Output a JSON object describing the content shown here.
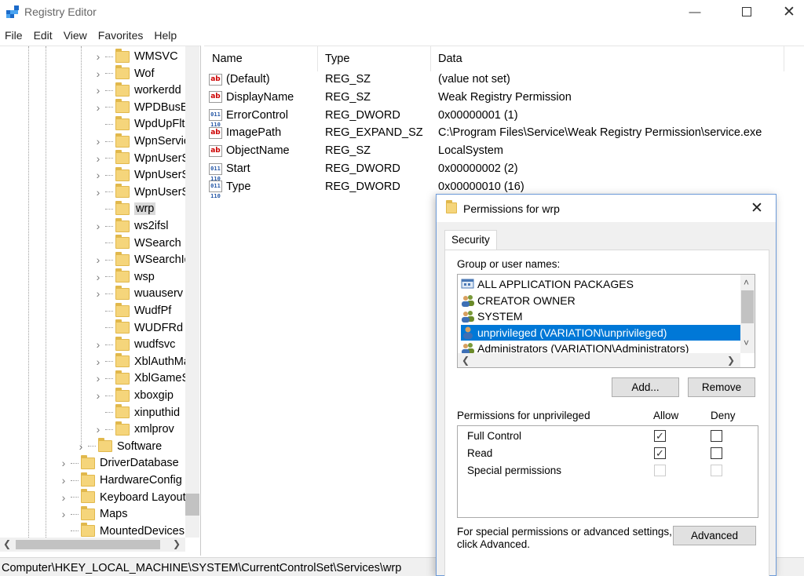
{
  "window": {
    "title": "Registry Editor"
  },
  "menu": [
    "File",
    "Edit",
    "View",
    "Favorites",
    "Help"
  ],
  "tree": {
    "services": [
      "WMSVC",
      "Wof",
      "workerdd",
      "WPDBusEn",
      "WpdUpFltr",
      "WpnServic",
      "WpnUserSe",
      "WpnUserSe",
      "WpnUserSe",
      "wrp",
      "ws2ifsl",
      "WSearch",
      "WSearchIdx",
      "wsp",
      "wuauserv",
      "WudfPf",
      "WUDFRd",
      "wudfsvc",
      "XblAuthMa",
      "XblGameSa",
      "xboxgip",
      "xinputhid",
      "xmlprov"
    ],
    "software": "Software",
    "system": [
      "DriverDatabase",
      "HardwareConfig",
      "Keyboard Layout",
      "Maps",
      "MountedDevices"
    ]
  },
  "list": {
    "columns": {
      "name": "Name",
      "type": "Type",
      "data": "Data"
    },
    "values": [
      {
        "name": "(Default)",
        "type": "REG_SZ",
        "data": "(value not set)",
        "icon": "string-value-icon"
      },
      {
        "name": "DisplayName",
        "type": "REG_SZ",
        "data": "Weak Registry Permission",
        "icon": "string-value-icon"
      },
      {
        "name": "ErrorControl",
        "type": "REG_DWORD",
        "data": "0x00000001 (1)",
        "icon": "binary-value-icon"
      },
      {
        "name": "ImagePath",
        "type": "REG_EXPAND_SZ",
        "data": "C:\\Program Files\\Service\\Weak Registry Permission\\service.exe",
        "icon": "string-value-icon"
      },
      {
        "name": "ObjectName",
        "type": "REG_SZ",
        "data": "LocalSystem",
        "icon": "string-value-icon"
      },
      {
        "name": "Start",
        "type": "REG_DWORD",
        "data": "0x00000002 (2)",
        "icon": "binary-value-icon"
      },
      {
        "name": "Type",
        "type": "REG_DWORD",
        "data": "0x00000010 (16)",
        "icon": "binary-value-icon"
      }
    ]
  },
  "status": "Computer\\HKEY_LOCAL_MACHINE\\SYSTEM\\CurrentControlSet\\Services\\wrp",
  "dialog": {
    "title": "Permissions for wrp",
    "tab": "Security",
    "group_label": "Group or user names:",
    "users": [
      {
        "name": "ALL APPLICATION PACKAGES",
        "icon": "packages-icon"
      },
      {
        "name": "CREATOR OWNER",
        "icon": "users-group-icon"
      },
      {
        "name": "SYSTEM",
        "icon": "users-group-icon"
      },
      {
        "name": "unprivileged (VARIATION\\unprivileged)",
        "icon": "user-icon"
      },
      {
        "name": "Administrators (VARIATION\\Administrators)",
        "icon": "users-group-icon"
      }
    ],
    "add_label": "Add...",
    "remove_label": "Remove",
    "perm_header": "Permissions for unprivileged",
    "allow_label": "Allow",
    "deny_label": "Deny",
    "permissions": [
      {
        "name": "Full Control",
        "allow": true,
        "deny": false,
        "enabled": true
      },
      {
        "name": "Read",
        "allow": true,
        "deny": false,
        "enabled": true
      },
      {
        "name": "Special permissions",
        "allow": false,
        "deny": false,
        "enabled": false
      }
    ],
    "advanced_text_1": "For special permissions or advanced settings,",
    "advanced_text_2": "click Advanced.",
    "advanced_label": "Advanced",
    "colors": {
      "selection": "#0078d7",
      "dialog_border": "#6c9ad8"
    }
  }
}
